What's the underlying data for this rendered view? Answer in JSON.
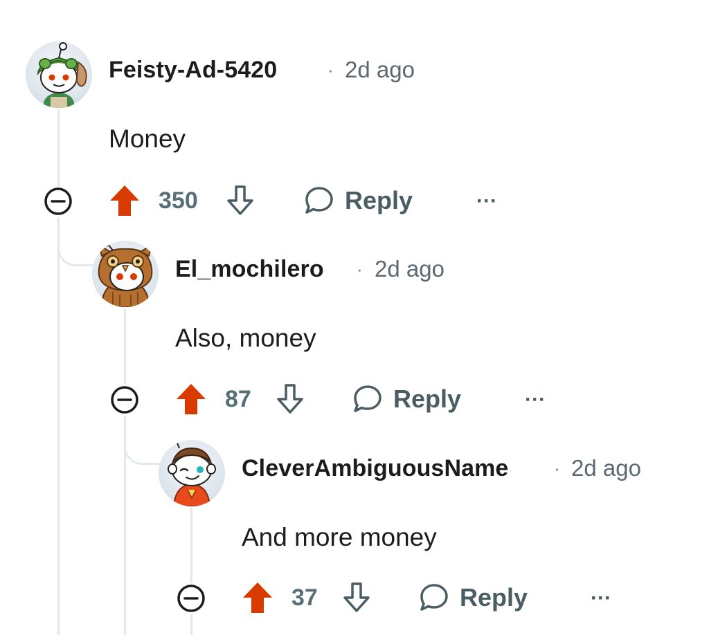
{
  "comments": [
    {
      "username": "Feisty-Ad-5420",
      "separator": "·",
      "time": "2d ago",
      "body": "Money",
      "score": "350",
      "reply_label": "Reply",
      "more_label": "···",
      "avatar_icon": "snoo-frog-hat-avatar"
    },
    {
      "username": "El_mochilero",
      "separator": "·",
      "time": "2d ago",
      "body": "Also, money",
      "score": "87",
      "reply_label": "Reply",
      "more_label": "···",
      "avatar_icon": "snoo-owl-costume-avatar"
    },
    {
      "username": "CleverAmbiguousName",
      "separator": "·",
      "time": "2d ago",
      "body": "And more money",
      "score": "37",
      "reply_label": "Reply",
      "more_label": "···",
      "avatar_icon": "snoo-winking-avatar"
    }
  ],
  "colors": {
    "upvote_active": "#d93a00",
    "thread_line": "#e5e8ea",
    "meta_text": "#5c6870"
  }
}
